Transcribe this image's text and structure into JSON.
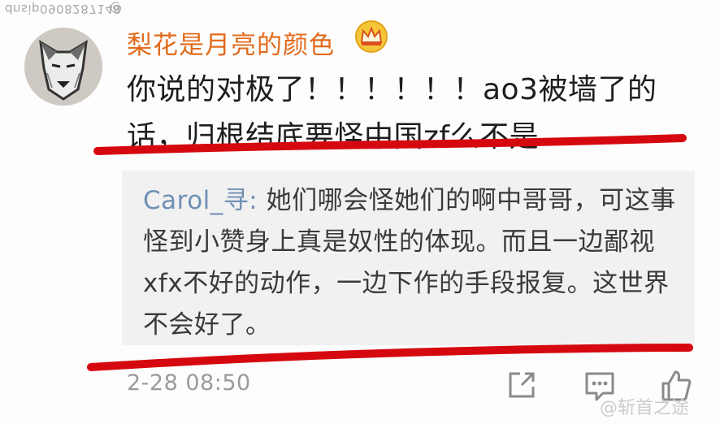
{
  "watermark_top": {
    "text": "dnsip0908287148",
    "at": "@",
    "nick": ""
  },
  "comment": {
    "username": "梨花是月亮的颜色",
    "content_line1": "你说的对极了！！！！！！ao3被墙了的",
    "content_line2": "话，归根结底要怪中国zf么不是"
  },
  "reply": {
    "username": "Carol_寻",
    "separator": ": ",
    "text": "她们哪会怪她们的啊中哥哥，可这事怪到小赞身上真是奴性的体现。而且一边鄙视xfx不好的动作，一边下作的手段报复。这世界不会好了。"
  },
  "timestamp": "2-28 08:50",
  "actions": {
    "share_icon": "share-icon",
    "comment_icon": "comment-icon",
    "like_icon": "thumbs-up-icon"
  },
  "watermark_bottom": "@斩首之途",
  "colors": {
    "username": "#e36a1c",
    "reply_username": "#6f90b5",
    "underline": "#d6080f",
    "quote_bg": "#f1f1f1"
  }
}
